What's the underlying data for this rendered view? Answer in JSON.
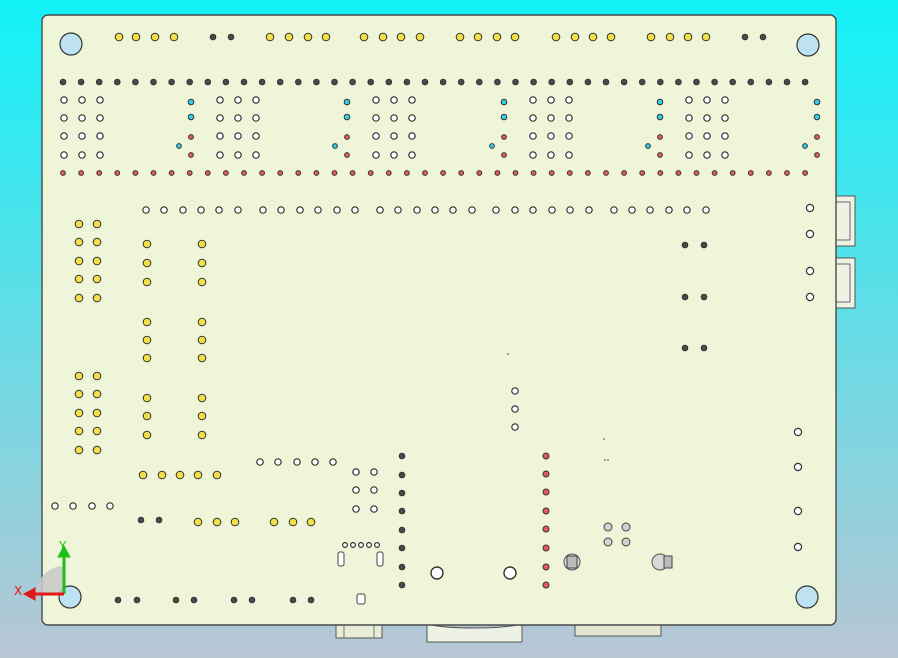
{
  "viewport": {
    "background_top": "#12f2f8",
    "background_bottom": "#b8c6d4"
  },
  "board": {
    "fill": "#eef5d8",
    "stroke": "#4a4a4a"
  },
  "pad_colors": {
    "yellow": "#f2e04a",
    "dark": "#4a4a4a",
    "white": "#ffffff",
    "cyan": "#2fd0e8",
    "red": "#e85a5a",
    "mount_hole": "#bfe2f2"
  },
  "axis_triad": {
    "x_label": "X",
    "y_label": "Y",
    "x_color": "#e01818",
    "y_color": "#18c018"
  }
}
